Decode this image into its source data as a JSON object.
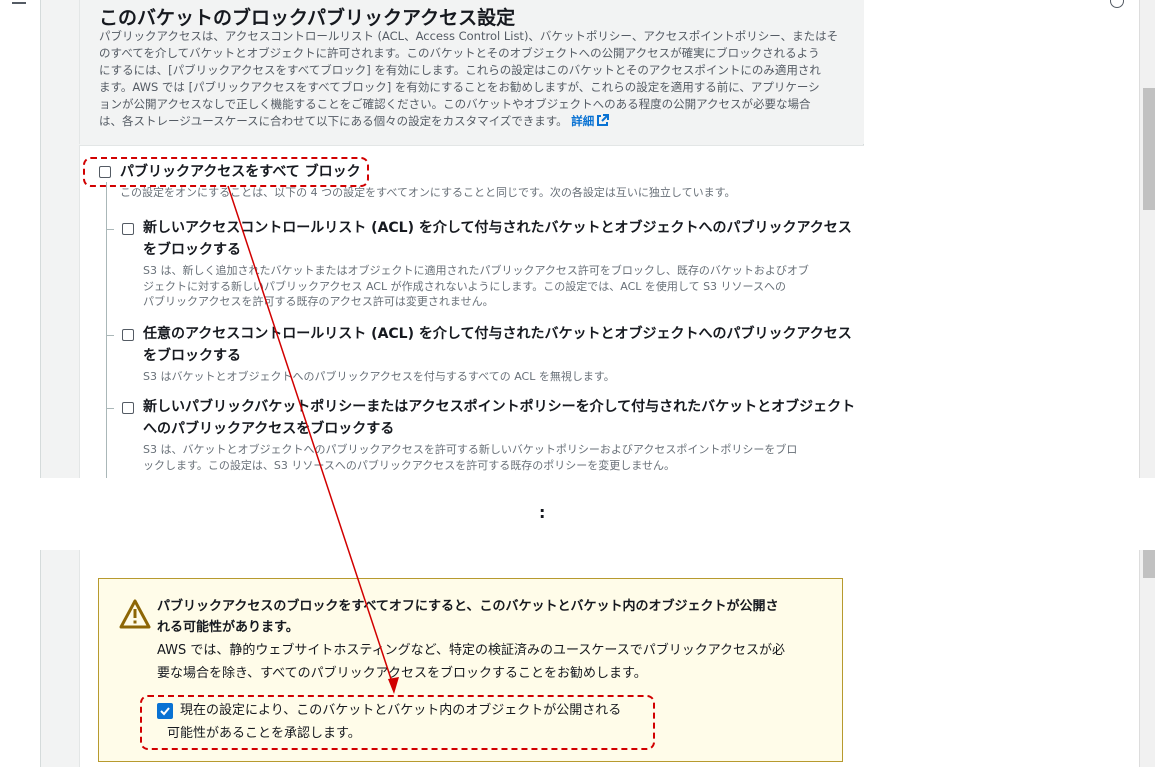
{
  "section": {
    "title": "このバケットのブロックパブリックアクセス設定",
    "description_lines": [
      "パブリックアクセスは、アクセスコントロールリスト (ACL、Access Control List)、バケットポリシー、アクセスポイントポリシー、またはそ",
      "のすべてを介してバケットとオブジェクトに許可されます。このバケットとそのオブジェクトへの公開アクセスが確実にブロックされるよう",
      "にするには、[パブリックアクセスをすべてブロック] を有効にします。これらの設定はこのバケットとそのアクセスポイントにのみ適用され",
      "ます。AWS では [パブリックアクセスをすべてブロック] を有効にすることをお勧めしますが、これらの設定を適用する前に、アプリケーシ",
      "ョンが公開アクセスなしで正しく機能することをご確認ください。このバケットやオブジェクトへのある程度の公開アクセスが必要な場合"
    ],
    "description_last_line": "は、各ストレージユースケースに合わせて以下にある個々の設定をカスタマイズできます。",
    "details_link": "詳細"
  },
  "block_all": {
    "label": "パブリックアクセスをすべて ブロック",
    "description": "この設定をオンにすることは、以下の 4 つの設定をすべてオンにすることと同じです。次の各設定は互いに独立しています。",
    "checked": false
  },
  "options": [
    {
      "title_lines": [
        "新しいアクセスコントロールリスト (ACL) を介して付与されたバケットとオブジェクトへのパブリックアクセス",
        "をブロックする"
      ],
      "desc_lines": [
        "S3 は、新しく追加されたバケットまたはオブジェクトに適用されたパブリックアクセス許可をブロックし、既存のバケットおよびオブ",
        "ジェクトに対する新しいパブリックアクセス ACL が作成されないようにします。この設定では、ACL を使用して S3 リソースへの",
        "パブリックアクセスを許可する既存のアクセス許可は変更されません。"
      ],
      "checked": false
    },
    {
      "title_lines": [
        "任意のアクセスコントロールリスト (ACL) を介して付与されたバケットとオブジェクトへのパブリックアクセス",
        "をブロックする"
      ],
      "desc_lines": [
        "S3 はバケットとオブジェクトへのパブリックアクセスを付与するすべての ACL を無視します。"
      ],
      "checked": false
    },
    {
      "title_lines": [
        "新しいパブリックバケットポリシーまたはアクセスポイントポリシーを介して付与されたバケットとオブジェクト",
        "へのパブリックアクセスをブロックする"
      ],
      "desc_lines": [
        "S3 は、バケットとオブジェクトへのパブリックアクセスを許可する新しいバケットポリシーおよびアクセスポイントポリシーをブロ",
        "ックします。この設定は、S3 リソースへのパブリックアクセスを許可する既存のポリシーを変更しません。"
      ],
      "checked": false
    }
  ],
  "separator": ":",
  "warning": {
    "icon": "warning-icon",
    "title_lines": [
      "パブリックアクセスのブロックをすべてオフにすると、このバケットとバケット内のオブジェクトが公開さ",
      "れる可能性があります。"
    ],
    "text_lines": [
      "AWS では、静的ウェブサイトホスティングなど、特定の検証済みのユースケースでパブリックアクセスが必",
      "要な場合を除き、すべてのパブリックアクセスをブロックすることをお勧めします。"
    ],
    "acknowledge_lines": [
      "現在の設定により、このバケットとバケット内のオブジェクトが公開される",
      "可能性があることを承認します。"
    ],
    "acknowledge_checked": true
  },
  "colors": {
    "annotation_red": "#d10000",
    "link_blue": "#0972d3",
    "warning_bg": "#fffce9",
    "warning_border": "#b79a2e"
  }
}
